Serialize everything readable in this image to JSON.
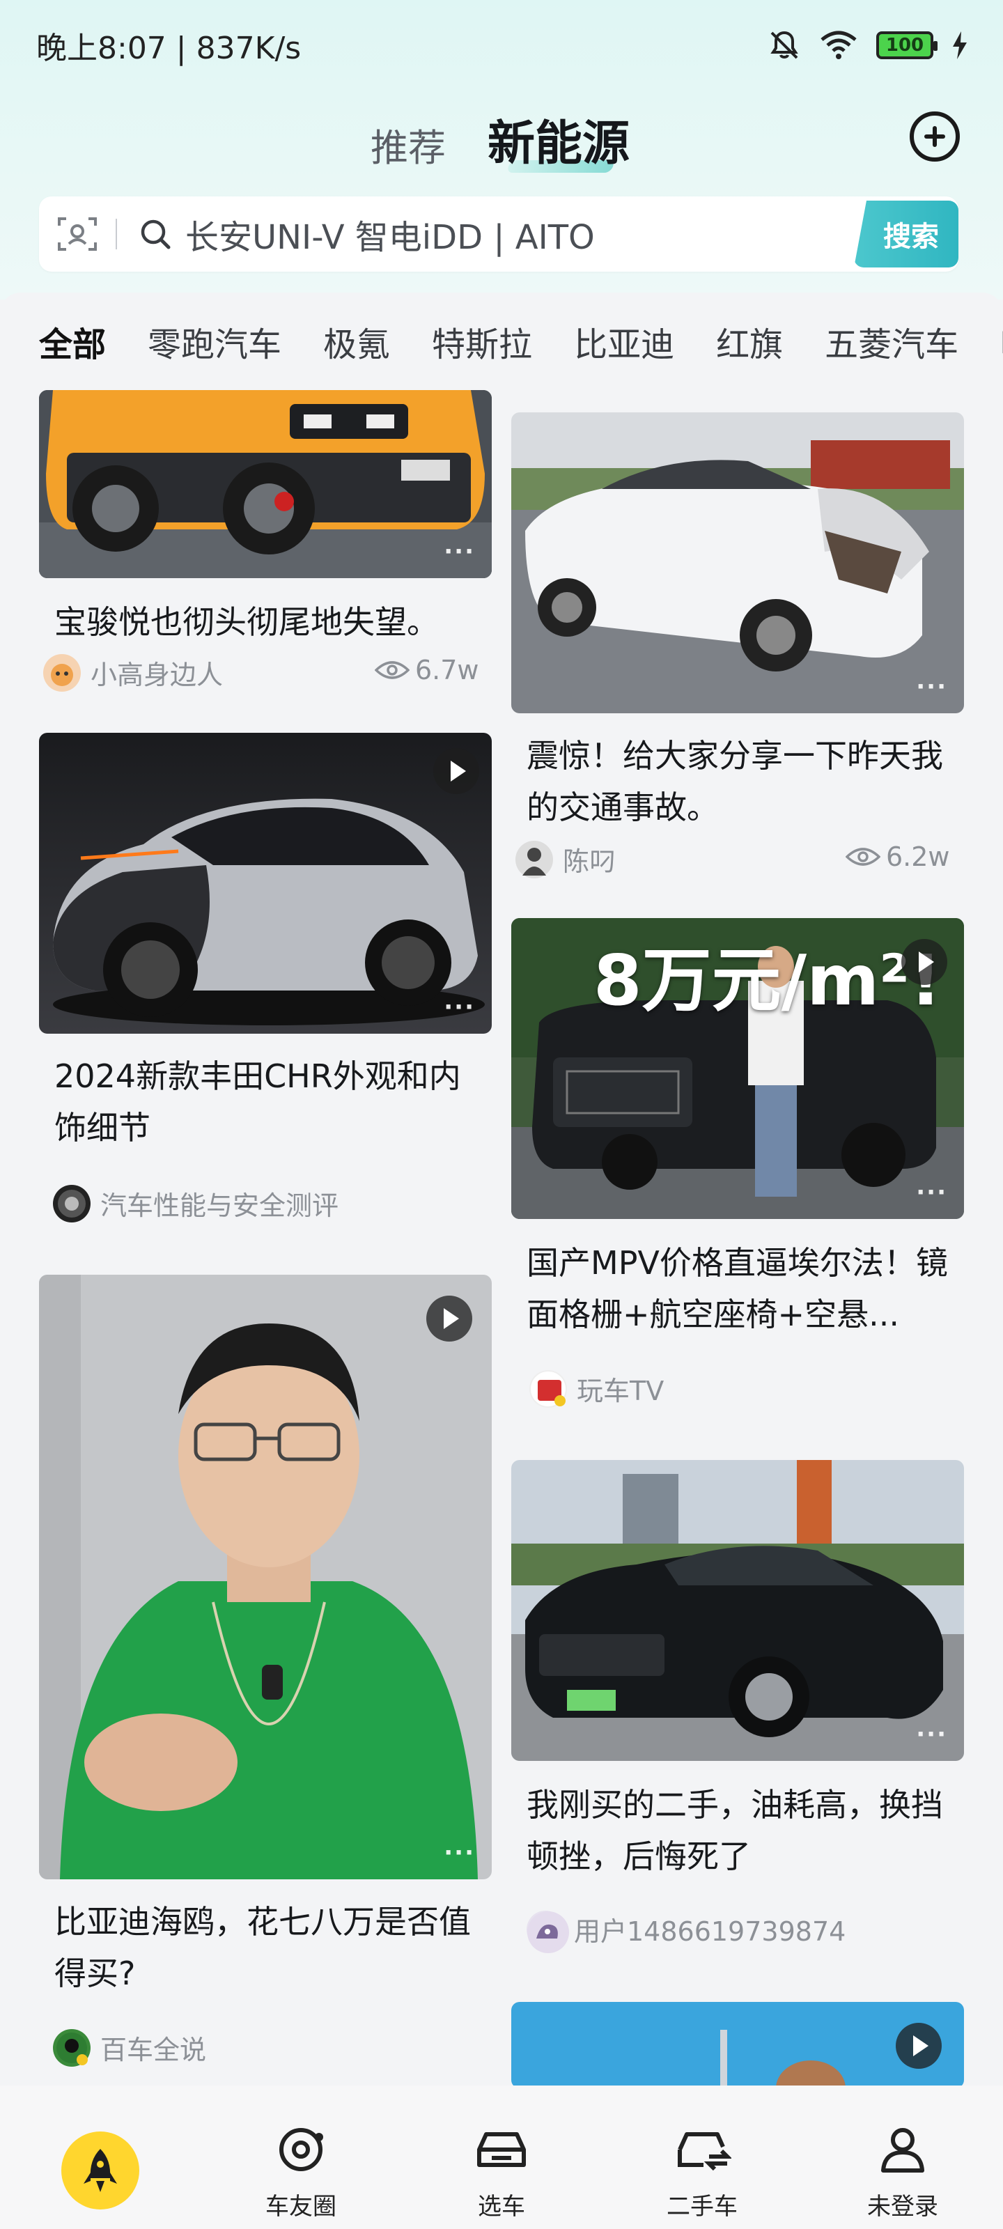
{
  "status_bar": {
    "time_speed": "晚上8:07 | 837K/s",
    "battery": "100"
  },
  "header": {
    "tab_recommend": "推荐",
    "tab_new_energy": "新能源"
  },
  "search": {
    "placeholder": "长安UNI-V 智电iDD | AITO",
    "button": "搜索"
  },
  "categories": [
    "全部",
    "零跑汽车",
    "极氪",
    "特斯拉",
    "比亚迪",
    "红旗",
    "五菱汽车",
    "哪"
  ],
  "feed": {
    "left": [
      {
        "title": "宝骏悦也彻头彻尾地失望。",
        "author": "小高身边人",
        "views": "6.7w"
      },
      {
        "title": "2024新款丰田CHR外观和内饰细节",
        "author": "汽车性能与安全测评"
      },
      {
        "title": "比亚迪海鸥，花七八万是否值得买?",
        "author": "百车全说"
      }
    ],
    "right": [
      {
        "title": "震惊！给大家分享一下昨天我的交通事故。",
        "author": "陈叼",
        "views": "6.2w"
      },
      {
        "title": "国产MPV价格直逼埃尔法！镜面格栅+航空座椅+空悬...",
        "author": "玩车TV",
        "overlay": "8万元/m²!"
      },
      {
        "title": "我刚买的二手，油耗高，换挡顿挫，后悔死了",
        "author": "用户1486619739874"
      }
    ]
  },
  "bottom_nav": [
    {
      "label": ""
    },
    {
      "label": "车友圈"
    },
    {
      "label": "选车"
    },
    {
      "label": "二手车"
    },
    {
      "label": "未登录"
    }
  ],
  "colors": {
    "accent": "#30b6c1",
    "header_bg": "#dff6f4",
    "rocket": "#ffd62e"
  }
}
